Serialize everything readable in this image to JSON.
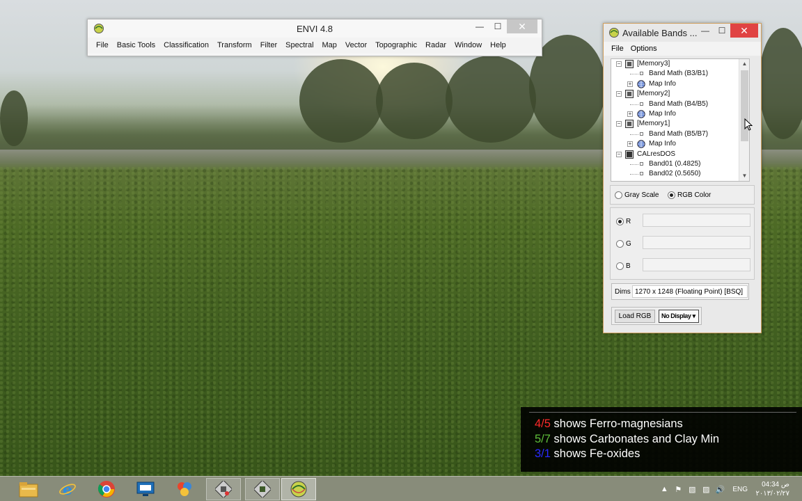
{
  "main_window": {
    "title": "ENVI 4.8",
    "menu": [
      "File",
      "Basic Tools",
      "Classification",
      "Transform",
      "Filter",
      "Spectral",
      "Map",
      "Vector",
      "Topographic",
      "Radar",
      "Window",
      "Help"
    ]
  },
  "bands_window": {
    "title": "Available Bands ...",
    "menu": [
      "File",
      "Options"
    ],
    "tree": [
      {
        "label": "[Memory3]"
      },
      {
        "label": "Band Math (B3/B1)"
      },
      {
        "label": "Map Info"
      },
      {
        "label": "[Memory2]"
      },
      {
        "label": "Band Math (B4/B5)"
      },
      {
        "label": "Map Info"
      },
      {
        "label": "[Memory1]"
      },
      {
        "label": "Band Math (B5/B7)"
      },
      {
        "label": "Map Info"
      },
      {
        "label": "CALresDOS"
      },
      {
        "label": "Band01 (0.4825)"
      },
      {
        "label": "Band02 (0.5650)"
      }
    ],
    "mode": {
      "gray_label": "Gray Scale",
      "rgb_label": "RGB Color",
      "selected": "rgb"
    },
    "channels": {
      "r_label": "R",
      "g_label": "G",
      "b_label": "B",
      "r_value": "",
      "g_value": "",
      "b_value": ""
    },
    "dims_label": "Dims",
    "dims_value": "1270 x 1248 (Floating Point) [BSQ]",
    "load_label": "Load RGB",
    "display_label": "No Display"
  },
  "annotation": {
    "lines": [
      {
        "ratio": "4/5",
        "text": " shows Ferro-magnesians",
        "color": "#ff2a2a"
      },
      {
        "ratio": "5/7",
        "text": " shows Carbonates and Clay Min",
        "color": "#5fbf3a"
      },
      {
        "ratio": "3/1",
        "text": " shows Fe-oxides",
        "color": "#2a2aff"
      }
    ]
  },
  "taskbar": {
    "apps": [
      "file-explorer",
      "internet-explorer",
      "chrome",
      "remote-desktop",
      "paint-app",
      "envi-app-1",
      "envi-app-2",
      "envi-app-3"
    ],
    "language": "ENG",
    "time": "04:34 ص",
    "date": "٢٠١٣/٠٢/٢٧"
  },
  "colors": {
    "accent_close": "#e04343",
    "window_border": "#d0a060"
  }
}
